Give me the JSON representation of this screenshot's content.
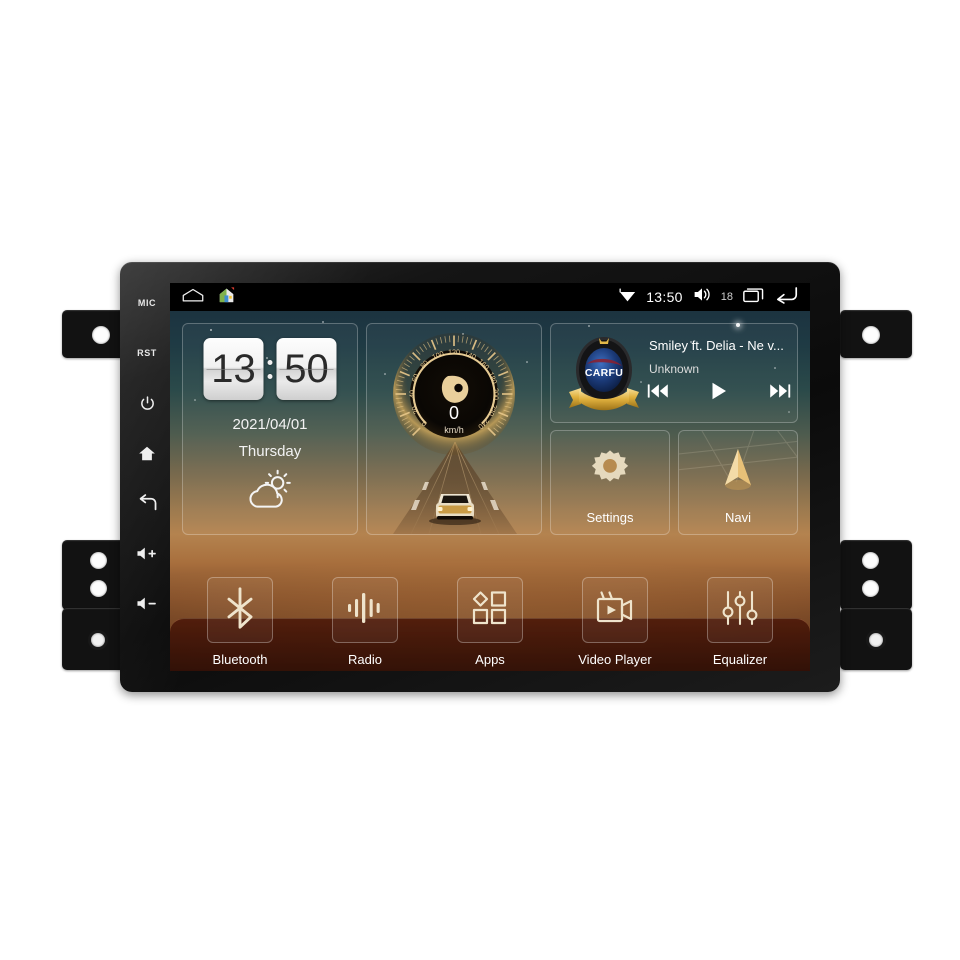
{
  "device": {
    "type": "android-car-head-unit",
    "hardware_keys": [
      {
        "name": "mic",
        "label": "MIC",
        "kind": "text"
      },
      {
        "name": "reset",
        "label": "RST",
        "kind": "text"
      },
      {
        "name": "power",
        "label": "",
        "kind": "power-icon"
      },
      {
        "name": "home",
        "label": "",
        "kind": "home-icon"
      },
      {
        "name": "back",
        "label": "",
        "kind": "back-icon"
      },
      {
        "name": "volume-up",
        "label": "",
        "kind": "volume-up-icon"
      },
      {
        "name": "volume-down",
        "label": "",
        "kind": "volume-down-icon"
      }
    ]
  },
  "statusbar": {
    "home_outline_icon": "home-outline-icon",
    "house_app_icon": "house-app-icon",
    "wifi_icon": "wifi-icon",
    "clock": "13:50",
    "volume_icon": "volume-icon",
    "volume_level": "18",
    "recents_icon": "recent-apps-icon",
    "back_icon": "back-arrow-icon"
  },
  "widgets": {
    "clock": {
      "hours": "13",
      "minutes": "50",
      "date": "2021/04/01",
      "weekday": "Thursday",
      "weather_icon": "partly-cloudy-icon"
    },
    "speedometer": {
      "value": "0",
      "unit": "km/h",
      "ticks": [
        "0",
        "20",
        "40",
        "60",
        "80",
        "100",
        "120",
        "140",
        "160",
        "180",
        "200",
        "220",
        "240"
      ],
      "max": 240
    },
    "media": {
      "badge_text": "CARFU",
      "title": "Smiley ft. Delia - Ne v...",
      "artist": "Unknown",
      "prev_icon": "skip-previous-icon",
      "play_icon": "play-icon",
      "next_icon": "skip-next-icon"
    },
    "tiles": [
      {
        "name": "settings",
        "label": "Settings",
        "icon": "gear-icon"
      },
      {
        "name": "navi",
        "label": "Navi",
        "icon": "navigation-arrow-icon"
      }
    ]
  },
  "dock": [
    {
      "name": "bluetooth",
      "label": "Bluetooth",
      "icon": "bluetooth-icon"
    },
    {
      "name": "radio",
      "label": "Radio",
      "icon": "radio-waveform-icon"
    },
    {
      "name": "apps",
      "label": "Apps",
      "icon": "apps-shapes-icon"
    },
    {
      "name": "video-player",
      "label": "Video Player",
      "icon": "video-camera-icon"
    },
    {
      "name": "equalizer",
      "label": "Equalizer",
      "icon": "equalizer-sliders-icon"
    }
  ],
  "colors": {
    "accent_gold": "#e8c178",
    "sky": "#1f3b44",
    "sunset": "#b4834f",
    "dock_band": "#4e1a0a",
    "badge_blue": "#1b3a78",
    "badge_gold": "#e3b949"
  }
}
